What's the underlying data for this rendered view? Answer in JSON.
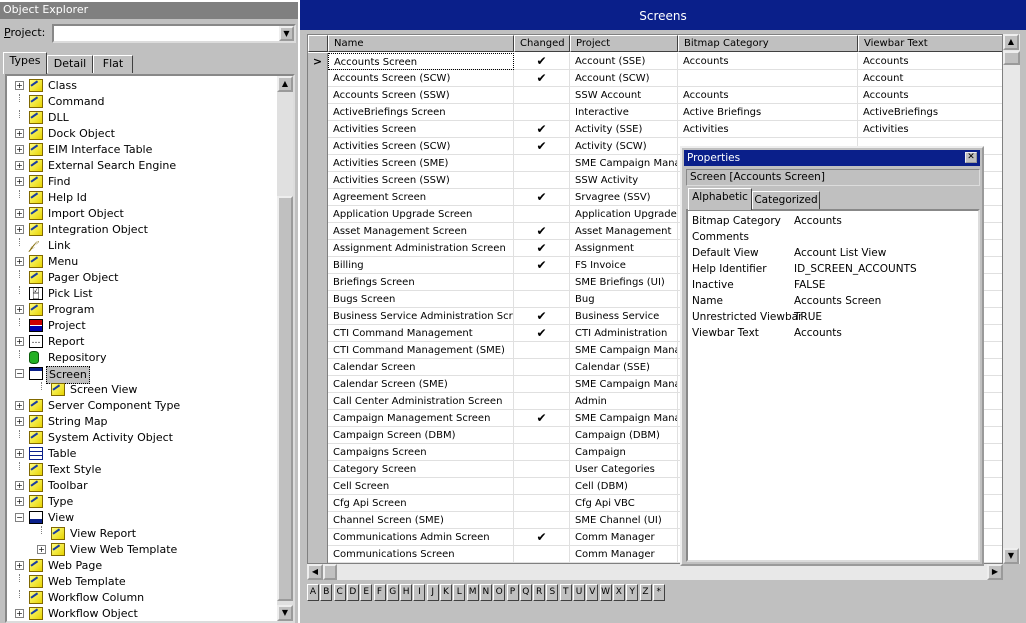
{
  "object_explorer": {
    "title": "Object Explorer",
    "project_label": "Project:",
    "project_value": "",
    "tabs": [
      {
        "label": "Types",
        "active": true
      },
      {
        "label": "Detail",
        "active": false
      },
      {
        "label": "Flat",
        "active": false
      }
    ],
    "tree": [
      {
        "label": "Class",
        "expand": "+",
        "icon": "folder-icon",
        "level": 0
      },
      {
        "label": "Command",
        "expand": "",
        "icon": "folder-icon",
        "level": 0
      },
      {
        "label": "DLL",
        "expand": "",
        "icon": "folder-icon",
        "level": 0
      },
      {
        "label": "Dock Object",
        "expand": "+",
        "icon": "folder-icon",
        "level": 0
      },
      {
        "label": "EIM Interface Table",
        "expand": "+",
        "icon": "folder-icon",
        "level": 0
      },
      {
        "label": "External Search Engine",
        "expand": "+",
        "icon": "folder-icon",
        "level": 0
      },
      {
        "label": "Find",
        "expand": "+",
        "icon": "folder-icon",
        "level": 0
      },
      {
        "label": "Help Id",
        "expand": "",
        "icon": "folder-icon",
        "level": 0
      },
      {
        "label": "Import Object",
        "expand": "+",
        "icon": "folder-icon",
        "level": 0
      },
      {
        "label": "Integration Object",
        "expand": "+",
        "icon": "folder-icon",
        "level": 0
      },
      {
        "label": "Link",
        "expand": "",
        "icon": "link-icon",
        "level": 0
      },
      {
        "label": "Menu",
        "expand": "+",
        "icon": "folder-icon",
        "level": 0
      },
      {
        "label": "Pager Object",
        "expand": "",
        "icon": "folder-icon",
        "level": 0
      },
      {
        "label": "Pick List",
        "expand": "",
        "icon": "pick-list-icon",
        "level": 0
      },
      {
        "label": "Program",
        "expand": "+",
        "icon": "folder-icon",
        "level": 0
      },
      {
        "label": "Project",
        "expand": "",
        "icon": "project-icon",
        "level": 0
      },
      {
        "label": "Report",
        "expand": "+",
        "icon": "report-icon",
        "level": 0
      },
      {
        "label": "Repository",
        "expand": "",
        "icon": "repository-icon",
        "level": 0
      },
      {
        "label": "Screen",
        "expand": "-",
        "icon": "screen-icon",
        "level": 0,
        "selected": true
      },
      {
        "label": "Screen View",
        "expand": "",
        "icon": "folder-icon",
        "level": 1
      },
      {
        "label": "Server Component Type",
        "expand": "+",
        "icon": "folder-icon",
        "level": 0
      },
      {
        "label": "String Map",
        "expand": "+",
        "icon": "folder-icon",
        "level": 0
      },
      {
        "label": "System Activity Object",
        "expand": "",
        "icon": "folder-icon",
        "level": 0
      },
      {
        "label": "Table",
        "expand": "+",
        "icon": "table-icon",
        "level": 0
      },
      {
        "label": "Text Style",
        "expand": "",
        "icon": "folder-icon",
        "level": 0
      },
      {
        "label": "Toolbar",
        "expand": "+",
        "icon": "folder-icon",
        "level": 0
      },
      {
        "label": "Type",
        "expand": "+",
        "icon": "folder-icon",
        "level": 0
      },
      {
        "label": "View",
        "expand": "-",
        "icon": "view-icon",
        "level": 0
      },
      {
        "label": "View Report",
        "expand": "",
        "icon": "folder-icon",
        "level": 1
      },
      {
        "label": "View Web Template",
        "expand": "+",
        "icon": "folder-icon",
        "level": 1
      },
      {
        "label": "Web Page",
        "expand": "+",
        "icon": "folder-icon",
        "level": 0
      },
      {
        "label": "Web Template",
        "expand": "",
        "icon": "folder-icon",
        "level": 0
      },
      {
        "label": "Workflow Column",
        "expand": "",
        "icon": "folder-icon",
        "level": 0
      },
      {
        "label": "Workflow Object",
        "expand": "+",
        "icon": "folder-icon",
        "level": 0
      }
    ]
  },
  "screens": {
    "title": "Screens",
    "columns": [
      "Name",
      "Changed",
      "Project",
      "Bitmap Category",
      "Viewbar Text"
    ],
    "rows": [
      {
        "name": "Accounts Screen",
        "changed": "✔",
        "project": "Account (SSE)",
        "bitmap": "Accounts",
        "viewbar": "Accounts",
        "current": true
      },
      {
        "name": "Accounts Screen (SCW)",
        "changed": "✔",
        "project": "Account (SCW)",
        "bitmap": "",
        "viewbar": "Account"
      },
      {
        "name": "Accounts Screen (SSW)",
        "changed": "",
        "project": "SSW Account",
        "bitmap": "Accounts",
        "viewbar": "Accounts"
      },
      {
        "name": "ActiveBriefings Screen",
        "changed": "",
        "project": "Interactive",
        "bitmap": "Active Briefings",
        "viewbar": "ActiveBriefings"
      },
      {
        "name": "Activities Screen",
        "changed": "✔",
        "project": "Activity (SSE)",
        "bitmap": "Activities",
        "viewbar": "Activities"
      },
      {
        "name": "Activities Screen (SCW)",
        "changed": "✔",
        "project": "Activity (SCW)",
        "bitmap": "",
        "viewbar": ""
      },
      {
        "name": "Activities Screen (SME)",
        "changed": "",
        "project": "SME Campaign Manag",
        "bitmap": "",
        "viewbar": ""
      },
      {
        "name": "Activities Screen (SSW)",
        "changed": "",
        "project": "SSW Activity",
        "bitmap": "",
        "viewbar": ""
      },
      {
        "name": "Agreement Screen",
        "changed": "✔",
        "project": "Srvagree (SSV)",
        "bitmap": "",
        "viewbar": ""
      },
      {
        "name": "Application Upgrade Screen",
        "changed": "",
        "project": "Application Upgrader",
        "bitmap": "",
        "viewbar": ""
      },
      {
        "name": "Asset Management Screen",
        "changed": "✔",
        "project": "Asset Management",
        "bitmap": "",
        "viewbar": ""
      },
      {
        "name": "Assignment Administration Screen",
        "changed": "✔",
        "project": "Assignment",
        "bitmap": "",
        "viewbar": ""
      },
      {
        "name": "Billing",
        "changed": "✔",
        "project": "FS Invoice",
        "bitmap": "",
        "viewbar": ""
      },
      {
        "name": "Briefings Screen",
        "changed": "",
        "project": "SME Briefings (UI)",
        "bitmap": "",
        "viewbar": ""
      },
      {
        "name": "Bugs Screen",
        "changed": "",
        "project": "Bug",
        "bitmap": "",
        "viewbar": ""
      },
      {
        "name": "Business Service Administration Screen",
        "changed": "✔",
        "project": "Business Service",
        "bitmap": "",
        "viewbar": ""
      },
      {
        "name": "CTI Command Management",
        "changed": "✔",
        "project": "CTI Administration",
        "bitmap": "",
        "viewbar": ""
      },
      {
        "name": "CTI Command Management (SME)",
        "changed": "",
        "project": "SME Campaign Manag",
        "bitmap": "",
        "viewbar": ""
      },
      {
        "name": "Calendar Screen",
        "changed": "",
        "project": "Calendar (SSE)",
        "bitmap": "",
        "viewbar": ""
      },
      {
        "name": "Calendar Screen (SME)",
        "changed": "",
        "project": "SME Campaign Manag",
        "bitmap": "",
        "viewbar": ""
      },
      {
        "name": "Call Center Administration Screen",
        "changed": "",
        "project": "Admin",
        "bitmap": "",
        "viewbar": ""
      },
      {
        "name": "Campaign Management Screen",
        "changed": "✔",
        "project": "SME Campaign Manag",
        "bitmap": "",
        "viewbar": ""
      },
      {
        "name": "Campaign Screen (DBM)",
        "changed": "",
        "project": "Campaign (DBM)",
        "bitmap": "",
        "viewbar": ""
      },
      {
        "name": "Campaigns Screen",
        "changed": "",
        "project": "Campaign",
        "bitmap": "",
        "viewbar": ""
      },
      {
        "name": "Category Screen",
        "changed": "",
        "project": "User Categories",
        "bitmap": "",
        "viewbar": ""
      },
      {
        "name": "Cell Screen",
        "changed": "",
        "project": "Cell (DBM)",
        "bitmap": "",
        "viewbar": ""
      },
      {
        "name": "Cfg Api Screen",
        "changed": "",
        "project": "Cfg Api VBC",
        "bitmap": "",
        "viewbar": ""
      },
      {
        "name": "Channel Screen (SME)",
        "changed": "",
        "project": "SME Channel (UI)",
        "bitmap": "",
        "viewbar": ""
      },
      {
        "name": "Communications Admin Screen",
        "changed": "✔",
        "project": "Comm Manager",
        "bitmap": "",
        "viewbar": ""
      },
      {
        "name": "Communications Screen",
        "changed": "",
        "project": "Comm Manager",
        "bitmap": "",
        "viewbar": ""
      }
    ],
    "alphabet": [
      "A",
      "B",
      "C",
      "D",
      "E",
      "F",
      "G",
      "H",
      "I",
      "J",
      "K",
      "L",
      "M",
      "N",
      "O",
      "P",
      "Q",
      "R",
      "S",
      "T",
      "U",
      "V",
      "W",
      "X",
      "Y",
      "Z",
      "*"
    ]
  },
  "properties": {
    "title": "Properties",
    "subtitle": "Screen [Accounts Screen]",
    "tabs": [
      {
        "label": "Alphabetic",
        "active": true
      },
      {
        "label": "Categorized",
        "active": false
      }
    ],
    "items": [
      {
        "name": "Bitmap Category",
        "value": "Accounts"
      },
      {
        "name": "Comments",
        "value": ""
      },
      {
        "name": "Default View",
        "value": "Account List View"
      },
      {
        "name": "Help Identifier",
        "value": "ID_SCREEN_ACCOUNTS"
      },
      {
        "name": "Inactive",
        "value": "FALSE"
      },
      {
        "name": "Name",
        "value": "Accounts Screen"
      },
      {
        "name": "Unrestricted Viewbar",
        "value": "TRUE"
      },
      {
        "name": "Viewbar Text",
        "value": "Accounts"
      }
    ]
  },
  "colors": {
    "title_blue": "#0a1f8a",
    "chrome_gray": "#c0c0c0"
  }
}
